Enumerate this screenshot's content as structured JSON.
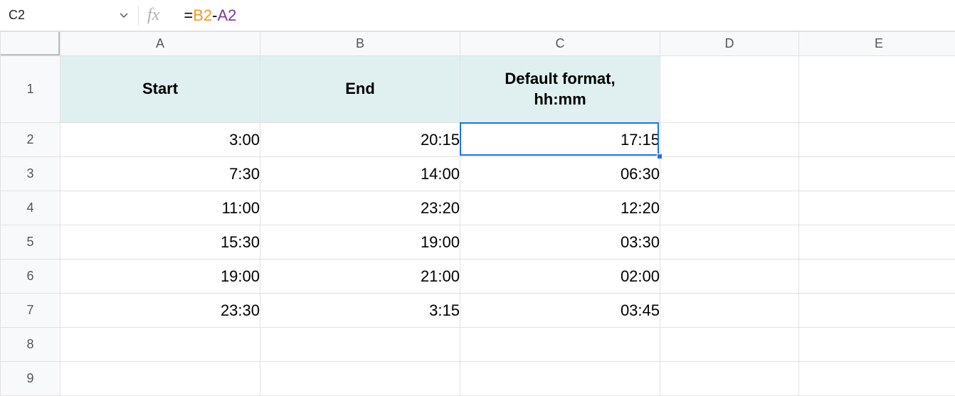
{
  "name_box": "C2",
  "formula": {
    "eq": "=",
    "ref1": "B2",
    "minus": "-",
    "ref2": "A2"
  },
  "columns": [
    "A",
    "B",
    "C",
    "D",
    "E"
  ],
  "row_numbers": [
    "1",
    "2",
    "3",
    "4",
    "5",
    "6",
    "7",
    "8",
    "9"
  ],
  "headers": {
    "A": "Start",
    "B": "End",
    "C": "Default format,\nhh:mm"
  },
  "data": [
    {
      "A": "3:00",
      "B": "20:15",
      "C": "17:15"
    },
    {
      "A": "7:30",
      "B": "14:00",
      "C": "06:30"
    },
    {
      "A": "11:00",
      "B": "23:20",
      "C": "12:20"
    },
    {
      "A": "15:30",
      "B": "19:00",
      "C": "03:30"
    },
    {
      "A": "19:00",
      "B": "21:00",
      "C": "02:00"
    },
    {
      "A": "23:30",
      "B": "3:15",
      "C": "03:45"
    }
  ],
  "selected_cell": "C2",
  "chart_data": {
    "type": "table",
    "columns": [
      "Start",
      "End",
      "Default format, hh:mm"
    ],
    "rows": [
      [
        "3:00",
        "20:15",
        "17:15"
      ],
      [
        "7:30",
        "14:00",
        "06:30"
      ],
      [
        "11:00",
        "23:20",
        "12:20"
      ],
      [
        "15:30",
        "19:00",
        "03:30"
      ],
      [
        "19:00",
        "21:00",
        "02:00"
      ],
      [
        "23:30",
        "3:15",
        "03:45"
      ]
    ]
  }
}
